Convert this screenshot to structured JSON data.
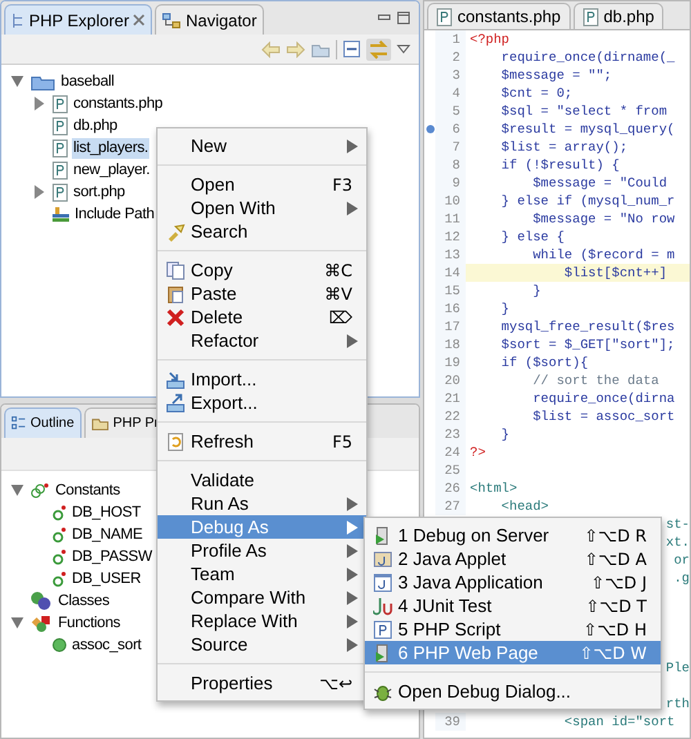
{
  "explorer": {
    "tabs": [
      {
        "label": "PHP Explorer",
        "selected": true,
        "closable": true
      },
      {
        "label": "Navigator",
        "selected": false,
        "closable": false
      }
    ],
    "tree": [
      {
        "label": "baseball",
        "kind": "project",
        "selected": false,
        "expanded": true,
        "children": [
          {
            "label": "constants.php",
            "kind": "file",
            "selected": false,
            "expanded": false
          },
          {
            "label": "db.php",
            "kind": "file",
            "selected": false
          },
          {
            "label": "list_players.",
            "kind": "file",
            "selected": true
          },
          {
            "label": "new_player.",
            "kind": "file",
            "selected": false
          },
          {
            "label": "sort.php",
            "kind": "file",
            "selected": false,
            "expanded": false
          },
          {
            "label": "Include Path",
            "kind": "library",
            "selected": false
          }
        ]
      }
    ]
  },
  "outline": {
    "tabs": [
      {
        "label": "Outline",
        "selected": true
      },
      {
        "label": "PHP Pr",
        "selected": false
      }
    ],
    "tree": [
      {
        "label": "Constants",
        "kind": "constants",
        "expanded": true,
        "children": [
          {
            "label": "DB_HOST",
            "kind": "constant"
          },
          {
            "label": "DB_NAME",
            "kind": "constant"
          },
          {
            "label": "DB_PASSW",
            "kind": "constant"
          },
          {
            "label": "DB_USER",
            "kind": "constant"
          }
        ]
      },
      {
        "label": "Classes",
        "kind": "classes"
      },
      {
        "label": "Functions",
        "kind": "functions",
        "expanded": true,
        "children": [
          {
            "label": "assoc_sort",
            "kind": "function"
          }
        ]
      }
    ]
  },
  "editor": {
    "tabs": [
      {
        "label": "constants.php",
        "selected": false
      },
      {
        "label": "db.php",
        "selected": false
      }
    ],
    "lines": [
      {
        "number": "1",
        "text": "<?php",
        "kind": "delim",
        "highlighted": false,
        "breakpoint": false
      },
      {
        "number": "2",
        "text": "    require_once(dirname(_",
        "kind": "php",
        "highlighted": false,
        "breakpoint": false
      },
      {
        "number": "3",
        "text": "    $message = \"\";",
        "kind": "php",
        "highlighted": false,
        "breakpoint": false
      },
      {
        "number": "4",
        "text": "    $cnt = 0;",
        "kind": "php",
        "highlighted": false,
        "breakpoint": false
      },
      {
        "number": "5",
        "text": "    $sql = \"select * from",
        "kind": "php",
        "highlighted": false,
        "breakpoint": false
      },
      {
        "number": "6",
        "text": "    $result = mysql_query(",
        "kind": "php",
        "highlighted": false,
        "breakpoint": true
      },
      {
        "number": "7",
        "text": "    $list = array();",
        "kind": "php",
        "highlighted": false,
        "breakpoint": false
      },
      {
        "number": "8",
        "text": "    if (!$result) {",
        "kind": "php",
        "highlighted": false,
        "breakpoint": false
      },
      {
        "number": "9",
        "text": "        $message = \"Could",
        "kind": "php",
        "highlighted": false,
        "breakpoint": false
      },
      {
        "number": "10",
        "text": "    } else if (mysql_num_r",
        "kind": "php",
        "highlighted": false,
        "breakpoint": false
      },
      {
        "number": "11",
        "text": "        $message = \"No row",
        "kind": "php",
        "highlighted": false,
        "breakpoint": false
      },
      {
        "number": "12",
        "text": "    } else {",
        "kind": "php",
        "highlighted": false,
        "breakpoint": false
      },
      {
        "number": "13",
        "text": "        while ($record = m",
        "kind": "php",
        "highlighted": false,
        "breakpoint": false
      },
      {
        "number": "14",
        "text": "            $list[$cnt++]",
        "kind": "php",
        "highlighted": true,
        "breakpoint": false
      },
      {
        "number": "15",
        "text": "        }",
        "kind": "php",
        "highlighted": false,
        "breakpoint": false
      },
      {
        "number": "16",
        "text": "    }",
        "kind": "php",
        "highlighted": false,
        "breakpoint": false
      },
      {
        "number": "17",
        "text": "    mysql_free_result($res",
        "kind": "php",
        "highlighted": false,
        "breakpoint": false
      },
      {
        "number": "18",
        "text": "    $sort = $_GET[\"sort\"];",
        "kind": "php",
        "highlighted": false,
        "breakpoint": false
      },
      {
        "number": "19",
        "text": "    if ($sort){",
        "kind": "php",
        "highlighted": false,
        "breakpoint": false
      },
      {
        "number": "20",
        "text": "        // sort the data",
        "kind": "comment",
        "highlighted": false,
        "breakpoint": false
      },
      {
        "number": "21",
        "text": "        require_once(dirna",
        "kind": "php",
        "highlighted": false,
        "breakpoint": false
      },
      {
        "number": "22",
        "text": "        $list = assoc_sort",
        "kind": "php",
        "highlighted": false,
        "breakpoint": false
      },
      {
        "number": "23",
        "text": "    }",
        "kind": "php",
        "highlighted": false,
        "breakpoint": false
      },
      {
        "number": "24",
        "text": "?>",
        "kind": "delim",
        "highlighted": false,
        "breakpoint": false
      },
      {
        "number": "25",
        "kind": "html",
        "highlighted": false,
        "breakpoint": false
      },
      {
        "number": "26",
        "text": "<html>",
        "kind": "html",
        "highlighted": false,
        "breakpoint": false
      },
      {
        "number": "27",
        "text": "    <head>",
        "kind": "html",
        "highlighted": false,
        "breakpoint": false
      },
      {
        "kind": "tail",
        "text": "st-"
      },
      {
        "kind": "tail",
        "text": "xt."
      },
      {
        "kind": "tail",
        "text": "or"
      },
      {
        "kind": "tail",
        "text": ".g"
      },
      {
        "kind": "tail"
      },
      {
        "kind": "tail"
      },
      {
        "kind": "tail"
      },
      {
        "kind": "tail"
      },
      {
        "kind": "tail",
        "text": "Ple"
      },
      {
        "kind": "tail"
      },
      {
        "kind": "tail",
        "text": "rth"
      },
      {
        "number": "39",
        "text": "            <span id=\"sort",
        "kind": "html",
        "highlighted": false,
        "breakpoint": false
      }
    ]
  },
  "context_menu": [
    {
      "kind": "plain",
      "label": "New",
      "submenu": true,
      "selected": false
    },
    {
      "kind": "separator"
    },
    {
      "kind": "plain",
      "label": "Open",
      "shortcut": "F3",
      "selected": false
    },
    {
      "kind": "plain",
      "label": "Open With",
      "submenu": true,
      "selected": false
    },
    {
      "kind": "search",
      "label": "Search",
      "selected": false
    },
    {
      "kind": "separator"
    },
    {
      "kind": "copy",
      "label": "Copy",
      "shortcut": "⌘C",
      "selected": false
    },
    {
      "kind": "paste",
      "label": "Paste",
      "shortcut": "⌘V",
      "selected": false
    },
    {
      "kind": "delete",
      "label": "Delete",
      "shortcut": "⌦",
      "selected": false
    },
    {
      "kind": "plain",
      "label": "Refactor",
      "submenu": true,
      "selected": false
    },
    {
      "kind": "separator"
    },
    {
      "kind": "import",
      "label": "Import...",
      "selected": false
    },
    {
      "kind": "export",
      "label": "Export...",
      "selected": false
    },
    {
      "kind": "separator"
    },
    {
      "kind": "refresh",
      "label": "Refresh",
      "shortcut": "F5",
      "selected": false
    },
    {
      "kind": "separator"
    },
    {
      "kind": "plain",
      "label": "Validate",
      "selected": false
    },
    {
      "kind": "plain",
      "label": "Run As",
      "submenu": true,
      "selected": false
    },
    {
      "kind": "plain",
      "label": "Debug As",
      "submenu": true,
      "selected": true
    },
    {
      "kind": "plain",
      "label": "Profile As",
      "submenu": true,
      "selected": false
    },
    {
      "kind": "plain",
      "label": "Team",
      "submenu": true,
      "selected": false
    },
    {
      "kind": "plain",
      "label": "Compare With",
      "submenu": true,
      "selected": false
    },
    {
      "kind": "plain",
      "label": "Replace With",
      "submenu": true,
      "selected": false
    },
    {
      "kind": "plain",
      "label": "Source",
      "submenu": true,
      "selected": false
    },
    {
      "kind": "separator"
    },
    {
      "kind": "plain",
      "label": "Properties",
      "shortcut": "⌥↩",
      "selected": false
    }
  ],
  "debug_submenu": [
    {
      "kind": "server",
      "label": "1 Debug on Server",
      "shortcut": "⇧⌥D R",
      "selected": false
    },
    {
      "kind": "applet",
      "label": "2 Java Applet",
      "shortcut": "⇧⌥D A",
      "selected": false
    },
    {
      "kind": "window",
      "label": "3 Java Application",
      "shortcut": "⇧⌥D J",
      "selected": false
    },
    {
      "kind": "junit",
      "label": "4 JUnit Test",
      "shortcut": "⇧⌥D T",
      "selected": false
    },
    {
      "kind": "script",
      "label": "5 PHP Script",
      "shortcut": "⇧⌥D H",
      "selected": false
    },
    {
      "kind": "server",
      "label": "6 PHP Web Page",
      "shortcut": "⇧⌥D W",
      "selected": true
    },
    {
      "kind": "separator"
    },
    {
      "kind": "bug",
      "label": "Open Debug Dialog...",
      "selected": false
    }
  ]
}
